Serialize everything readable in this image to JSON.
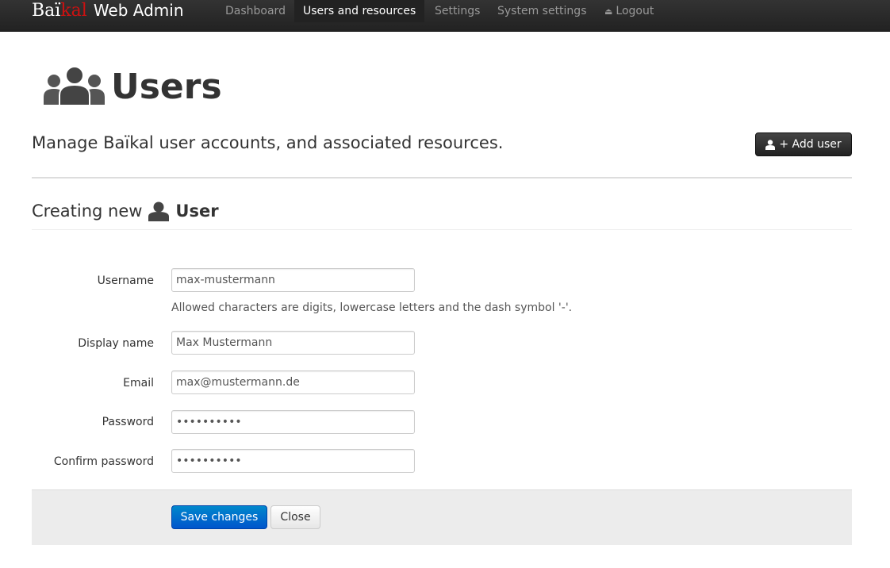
{
  "navbar": {
    "brand_part1": "Baï",
    "brand_part2": "kal",
    "brand_part3": "Web Admin",
    "items": [
      {
        "label": "Dashboard",
        "active": false
      },
      {
        "label": "Users and resources",
        "active": true
      },
      {
        "label": "Settings",
        "active": false
      },
      {
        "label": "System settings",
        "active": false
      },
      {
        "label": "Logout",
        "icon": "eject-icon"
      }
    ]
  },
  "header": {
    "icon": "users-group-icon",
    "title": "Users",
    "lead": "Manage Baïkal user accounts, and associated resources.",
    "add_user_label": "+ Add user",
    "add_user_icon": "user-icon"
  },
  "form": {
    "heading_prefix": "Creating new",
    "heading_icon": "user-icon",
    "heading_entity": "User",
    "fields": {
      "username": {
        "label": "Username",
        "value": "max-mustermann",
        "help": "Allowed characters are digits, lowercase letters and the dash symbol '-'."
      },
      "display_name": {
        "label": "Display name",
        "value": "Max Mustermann"
      },
      "email": {
        "label": "Email",
        "value": "max@mustermann.de"
      },
      "password": {
        "label": "Password",
        "value": "••••••••••"
      },
      "confirm_password": {
        "label": "Confirm password",
        "value": "••••••••••"
      }
    },
    "save_label": "Save changes",
    "close_label": "Close"
  },
  "colors": {
    "navbar_bg": "#222222",
    "brand_accent": "#cc1111",
    "primary_button": "#0077cc",
    "dark_button": "#333333",
    "actions_bg": "#ececec"
  }
}
